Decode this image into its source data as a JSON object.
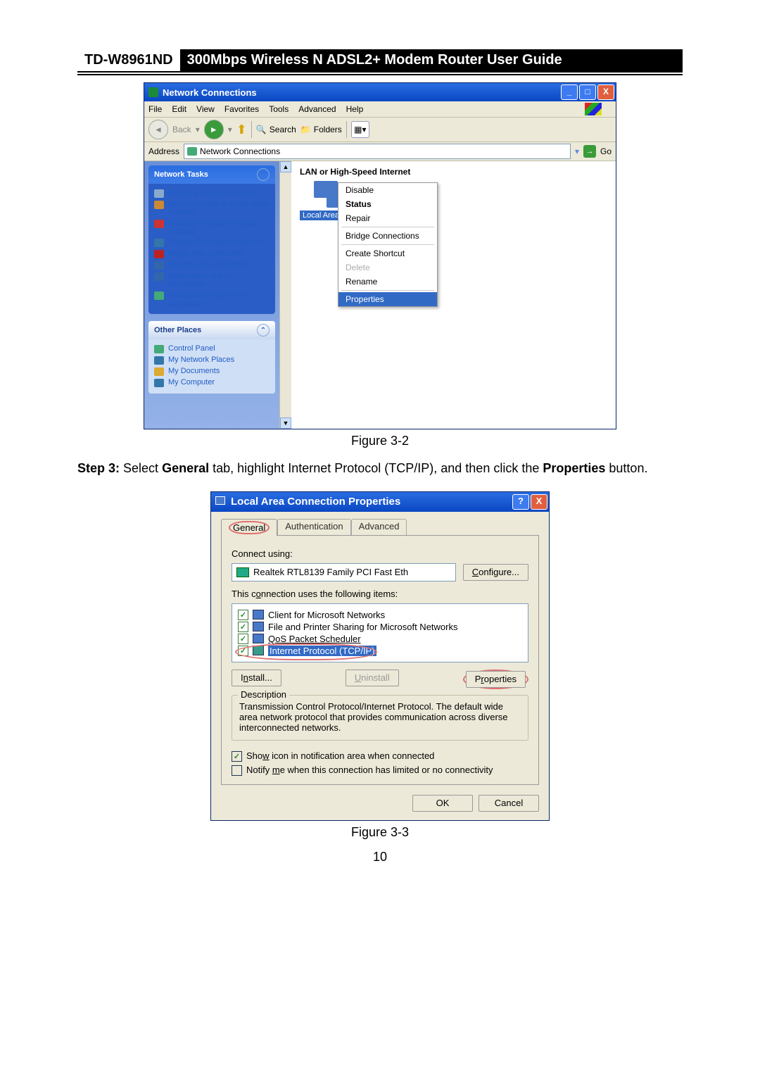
{
  "header": {
    "model": "TD-W8961ND",
    "title": "300Mbps Wireless N ADSL2+ Modem Router User Guide"
  },
  "win": {
    "title": "Network Connections",
    "menu": [
      "File",
      "Edit",
      "View",
      "Favorites",
      "Tools",
      "Advanced",
      "Help"
    ],
    "back": "Back",
    "search": "Search",
    "folders": "Folders",
    "addrLabel": "Address",
    "addrValue": "Network Connections",
    "go": "Go",
    "tasksHdr": "Network Tasks",
    "tasks": [
      "Create a new connection",
      "Set up a home or small office network",
      "Change Windows Firewall settings",
      "Disable this network device",
      "Repair this connection",
      "Rename this connection",
      "View status of this connection",
      "Change settings of this connection"
    ],
    "otherHdr": "Other Places",
    "other": [
      "Control Panel",
      "My Network Places",
      "My Documents",
      "My Computer"
    ],
    "section": "LAN or High-Speed Internet",
    "iconCaption": "Local Area Connection",
    "ctx": [
      "Disable",
      "Status",
      "Repair",
      "Bridge Connections",
      "Create Shortcut",
      "Delete",
      "Rename",
      "Properties"
    ]
  },
  "fig1": "Figure 3-2",
  "step": {
    "lead": "Step 3:",
    "a": "Select ",
    "b": "General",
    "c": " tab, highlight Internet Protocol (TCP/IP), and then click the ",
    "d": "Properties",
    "e": " button."
  },
  "dlg": {
    "title": "Local Area Connection Properties",
    "tabs": [
      "General",
      "Authentication",
      "Advanced"
    ],
    "connectUsing": "Connect using:",
    "adapter": "Realtek RTL8139 Family PCI Fast Eth",
    "configure": "Configure...",
    "usesItems": "This connection uses the following items:",
    "items": [
      "Client for Microsoft Networks",
      "File and Printer Sharing for Microsoft Networks",
      "QoS Packet Scheduler",
      "Internet Protocol (TCP/IP)"
    ],
    "install": "Install...",
    "uninstall": "Uninstall",
    "properties": "Properties",
    "descHdr": "Description",
    "desc": "Transmission Control Protocol/Internet Protocol. The default wide area network protocol that provides communication across diverse interconnected networks.",
    "showIcon": "Show icon in notification area when connected",
    "notify": "Notify me when this connection has limited or no connectivity",
    "ok": "OK",
    "cancel": "Cancel"
  },
  "fig2": "Figure 3-3",
  "page": "10"
}
